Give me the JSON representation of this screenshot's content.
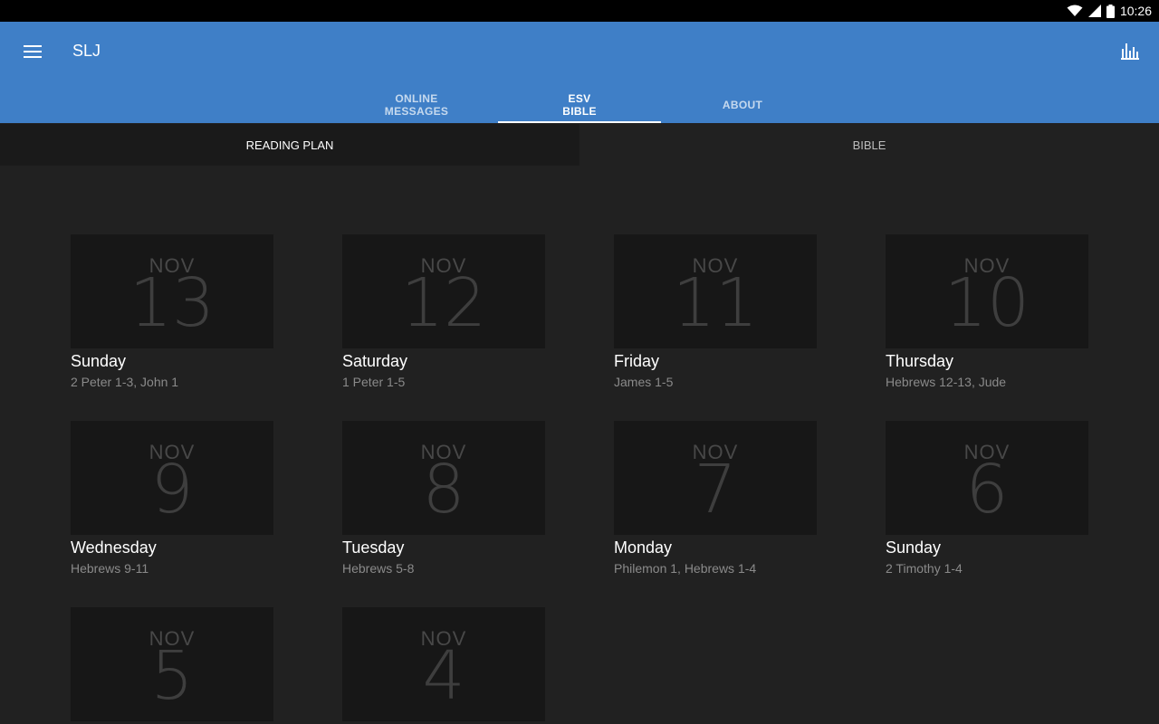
{
  "status_bar": {
    "time": "10:26"
  },
  "app_bar": {
    "title": "SLJ"
  },
  "tabs": [
    {
      "label_line1": "ONLINE",
      "label_line2": "MESSAGES",
      "active": false
    },
    {
      "label_line1": "ESV",
      "label_line2": "BIBLE",
      "active": true
    },
    {
      "label_line1": "ABOUT",
      "label_line2": "",
      "active": false
    }
  ],
  "sub_tabs": [
    {
      "label": "READING PLAN",
      "active": true
    },
    {
      "label": "BIBLE",
      "active": false
    }
  ],
  "readings": [
    {
      "month": "NOV",
      "day": "13",
      "weekday": "Sunday",
      "passage": "2 Peter 1-3, John 1"
    },
    {
      "month": "NOV",
      "day": "12",
      "weekday": "Saturday",
      "passage": "1 Peter 1-5"
    },
    {
      "month": "NOV",
      "day": "11",
      "weekday": "Friday",
      "passage": "James 1-5"
    },
    {
      "month": "NOV",
      "day": "10",
      "weekday": "Thursday",
      "passage": "Hebrews 12-13, Jude"
    },
    {
      "month": "NOV",
      "day": "9",
      "weekday": "Wednesday",
      "passage": "Hebrews 9-11"
    },
    {
      "month": "NOV",
      "day": "8",
      "weekday": "Tuesday",
      "passage": "Hebrews 5-8"
    },
    {
      "month": "NOV",
      "day": "7",
      "weekday": "Monday",
      "passage": "Philemon 1, Hebrews 1-4"
    },
    {
      "month": "NOV",
      "day": "6",
      "weekday": "Sunday",
      "passage": "2 Timothy 1-4"
    },
    {
      "month": "NOV",
      "day": "5",
      "weekday": "",
      "passage": ""
    },
    {
      "month": "NOV",
      "day": "4",
      "weekday": "",
      "passage": ""
    }
  ],
  "colors": {
    "app_bar": "#3f7fc7",
    "background": "#212121",
    "thumb": "#171717"
  }
}
